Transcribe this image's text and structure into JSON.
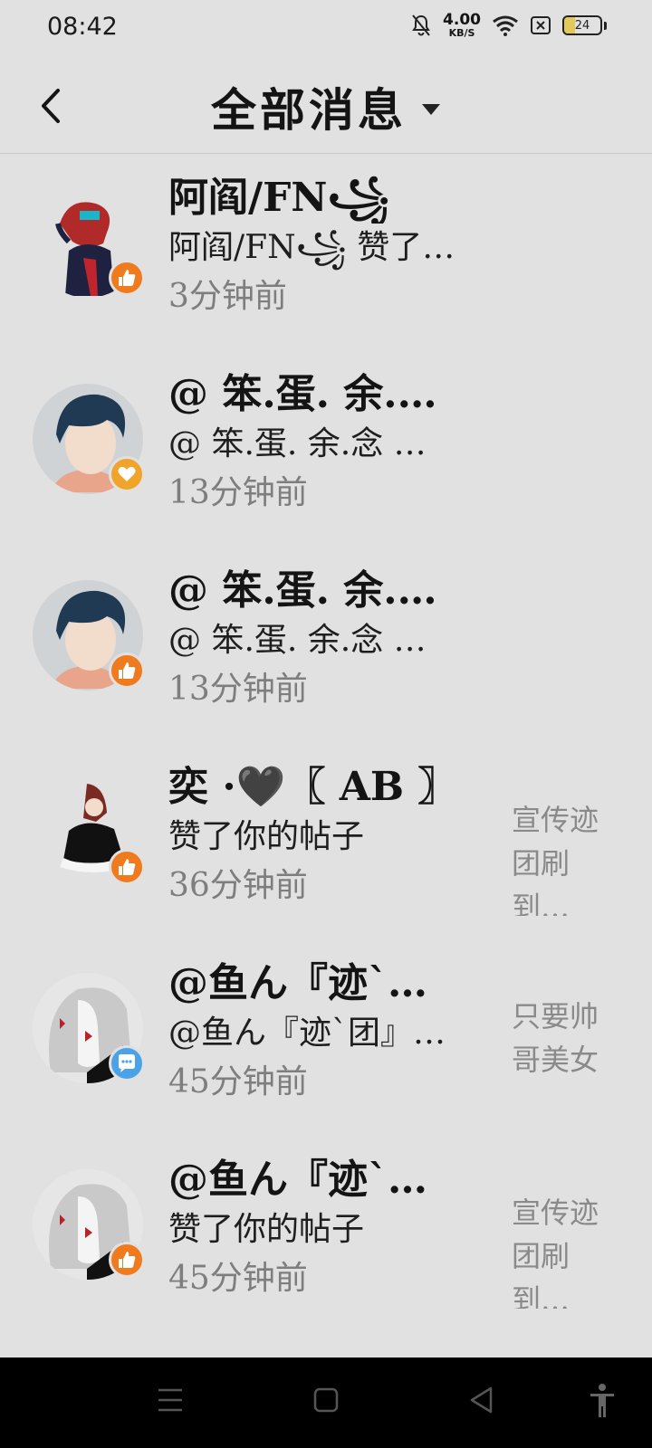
{
  "status": {
    "time": "08:42",
    "net_speed_value": "4.00",
    "net_speed_unit": "KB/S",
    "battery": "24"
  },
  "header": {
    "title": "全部消息"
  },
  "messages": [
    {
      "name": "阿阎/FN꧁",
      "content": "阿阎/FN꧁ 赞了…",
      "time": "3分钟前",
      "preview": "",
      "badge": "thumbs-up-icon"
    },
    {
      "name": "@ 笨.蛋. 余.…",
      "content": "@ 笨.蛋. 余.念 …",
      "time": "13分钟前",
      "preview": "",
      "badge": "heart-icon"
    },
    {
      "name": "@ 笨.蛋. 余.…",
      "content": "@ 笨.蛋. 余.念 …",
      "time": "13分钟前",
      "preview": "",
      "badge": "thumbs-up-icon"
    },
    {
      "name": "奕 ·🖤〖 AB 〗",
      "content": "赞了你的帖子",
      "time": "36分钟前",
      "preview": "宣传迹团刷到…",
      "badge": "thumbs-up-icon"
    },
    {
      "name": "@鱼ん『迹`…",
      "content": "@鱼ん『迹`团』…",
      "time": "45分钟前",
      "preview": "只要帅哥美女",
      "badge": "comment-icon"
    },
    {
      "name": "@鱼ん『迹`…",
      "content": "赞了你的帖子",
      "time": "45分钟前",
      "preview": "宣传迹团刷到…",
      "badge": "thumbs-up-icon"
    }
  ],
  "colors": {
    "background": "#e1e1e1",
    "like_badge": "#f07a1e",
    "heart_badge": "#f0a52a",
    "comment_badge": "#4aa3e8"
  }
}
